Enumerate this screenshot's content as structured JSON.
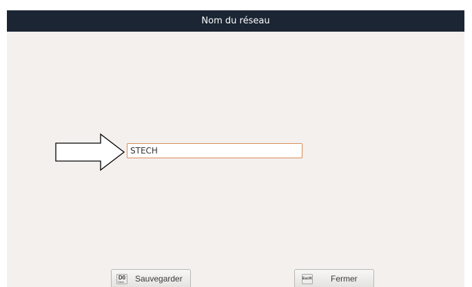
{
  "dialog": {
    "title": "Nom du réseau"
  },
  "network_name_field": {
    "value": "STECH"
  },
  "pointer_arrow": {
    "icon": "right-arrow-outline-icon"
  },
  "buttons": {
    "save": {
      "key": "D0",
      "key_sub": "Save",
      "label": "Sauvegarder",
      "icon": "key-d0-icon"
    },
    "close": {
      "key": "Esc/K",
      "label": "Fermer",
      "icon": "key-esc-icon"
    }
  },
  "colors": {
    "title_bar": "#1b2533",
    "panel_background": "#f3f0ed",
    "field_border": "#d78a57"
  }
}
